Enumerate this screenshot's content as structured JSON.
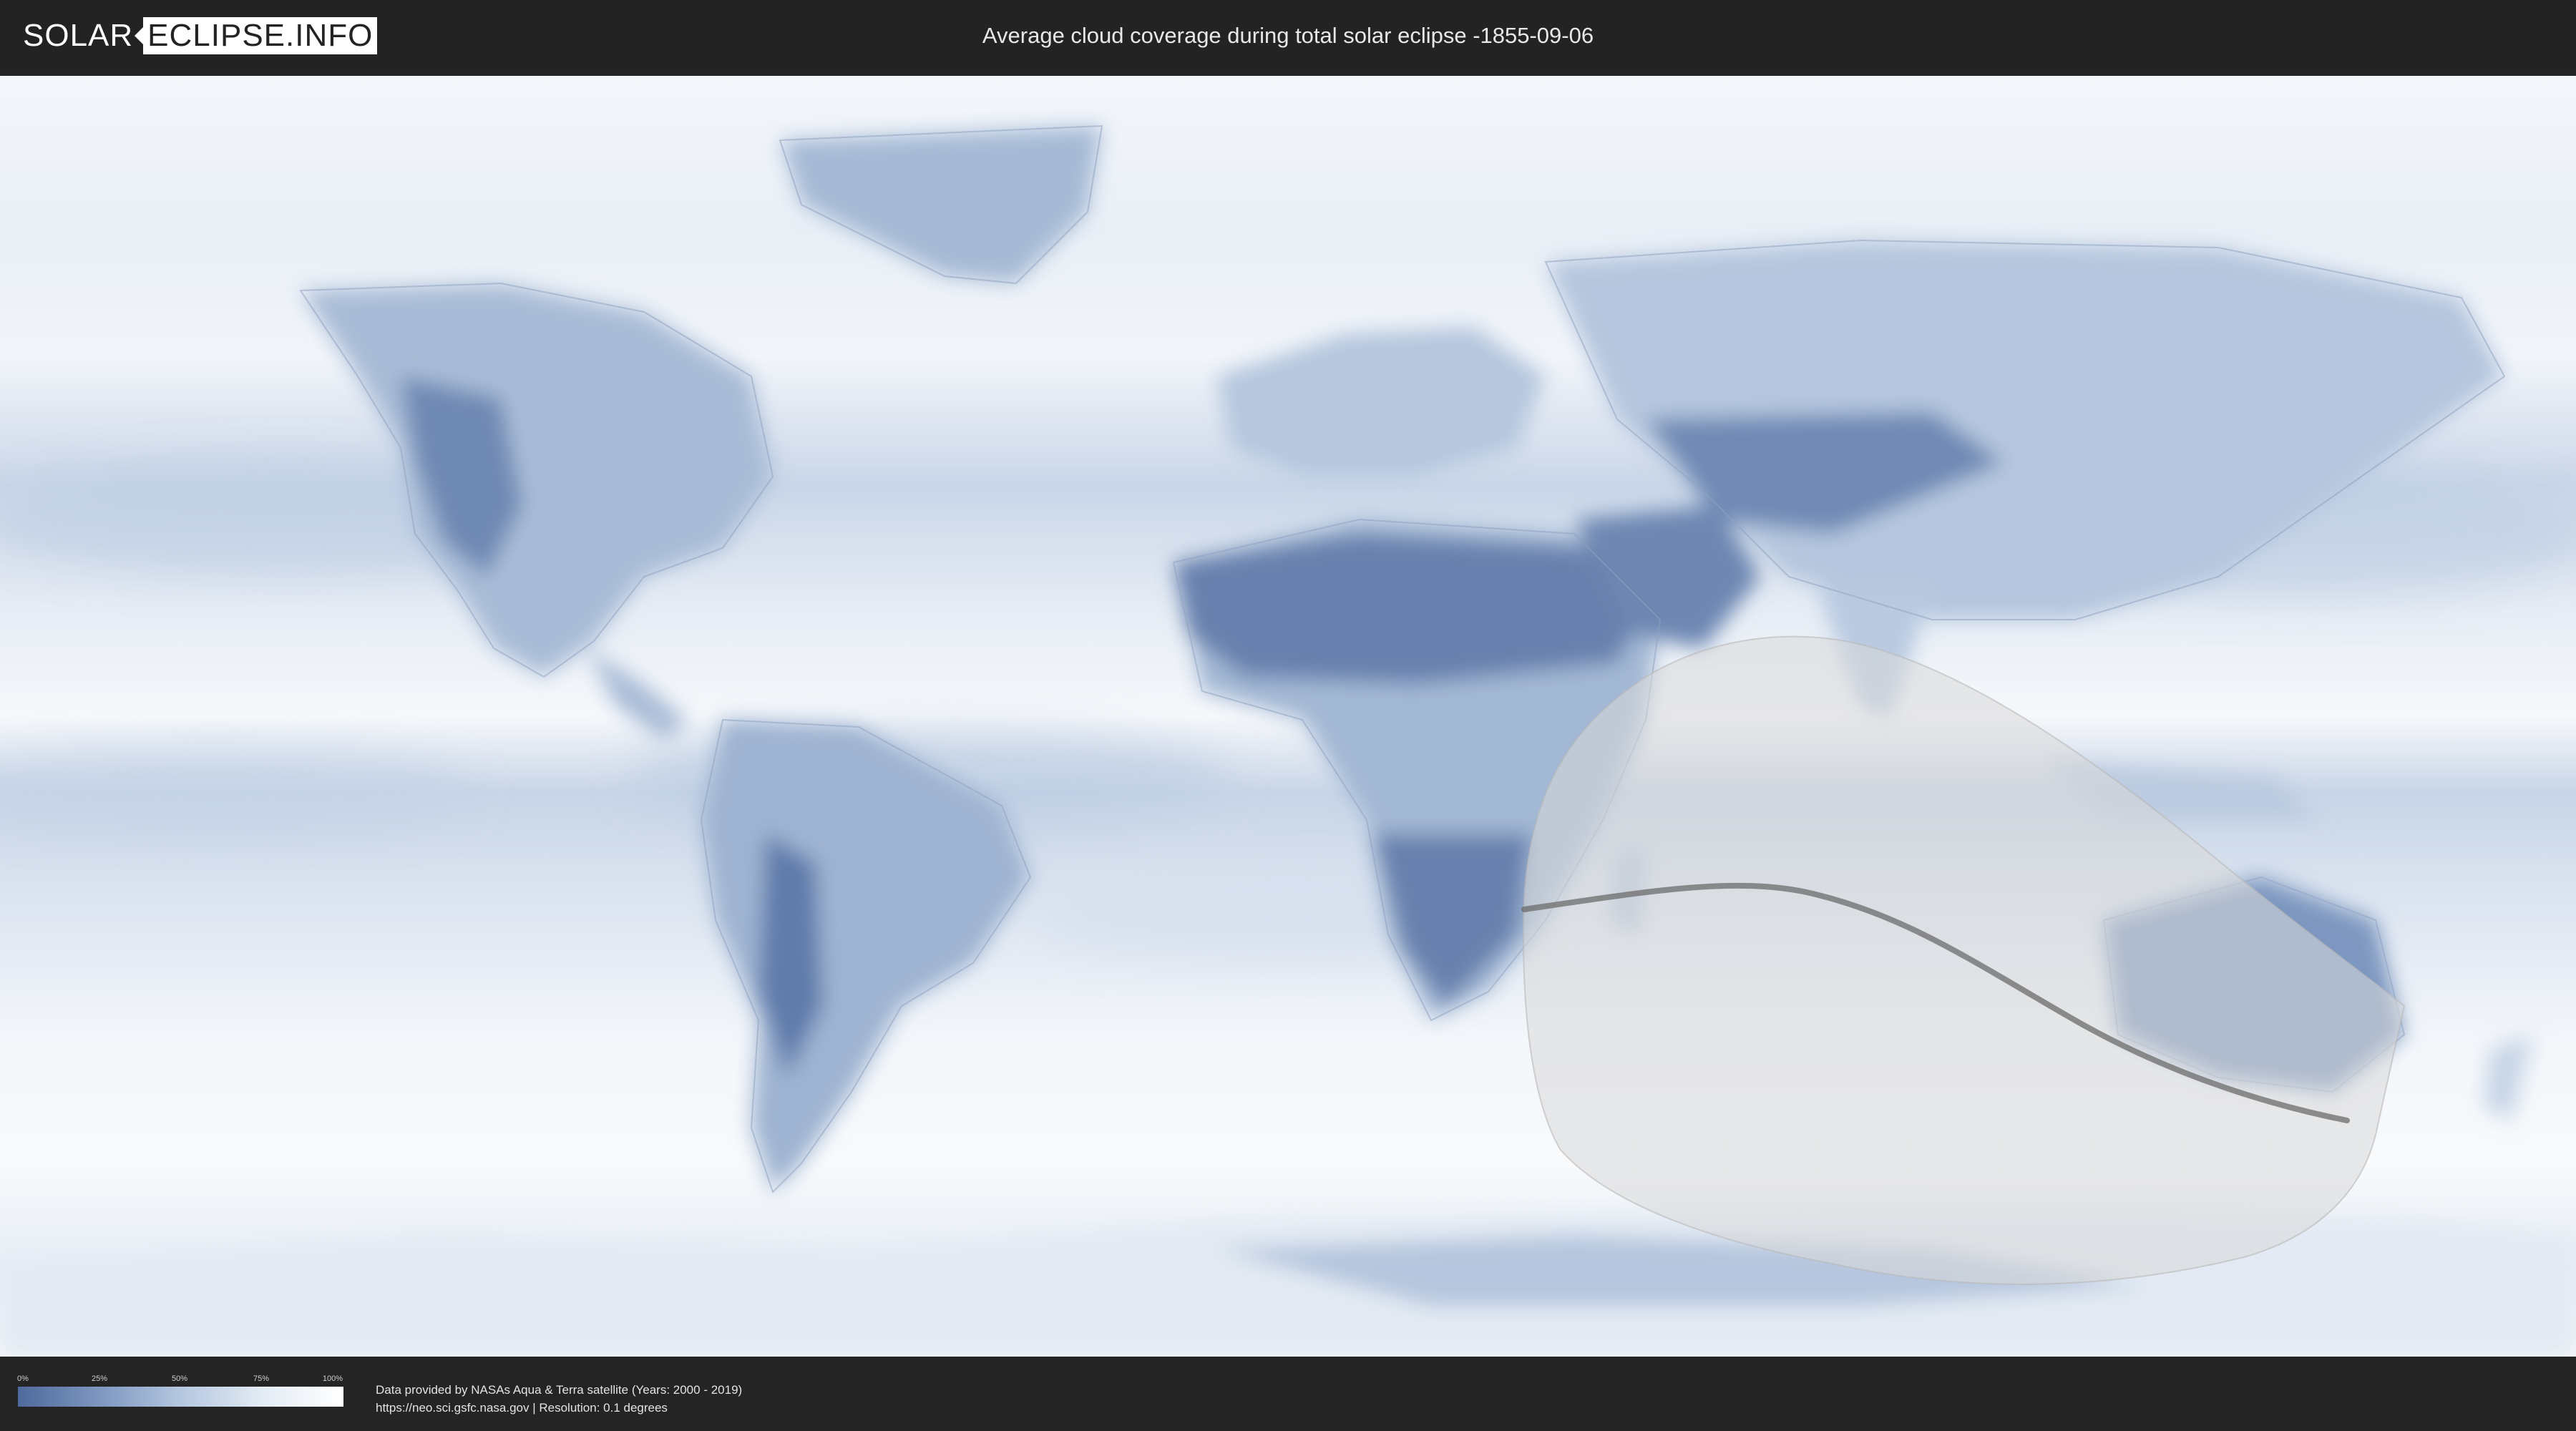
{
  "header": {
    "logo_left": "SOLAR",
    "logo_right": "ECLIPSE.INFO",
    "title": "Average cloud coverage during total solar eclipse -1855-09-06"
  },
  "map": {
    "description_colors": {
      "clear": "#4f6a9c",
      "cloudy": "#ffffff",
      "visibility_zone": "#d8d8d8",
      "central_line": "#6b6b6b"
    }
  },
  "legend": {
    "ticks": [
      "0%",
      "25%",
      "50%",
      "75%",
      "100%"
    ],
    "colors": [
      "#4f6a9c",
      "#7d97c0",
      "#b5c7e0",
      "#e3ebf4",
      "#ffffff"
    ]
  },
  "footer": {
    "credit_line_1": "Data provided by NASAs Aqua & Terra satellite (Years: 2000 - 2019)",
    "credit_line_2": "https://neo.sci.gsfc.nasa.gov | Resolution: 0.1 degrees"
  }
}
